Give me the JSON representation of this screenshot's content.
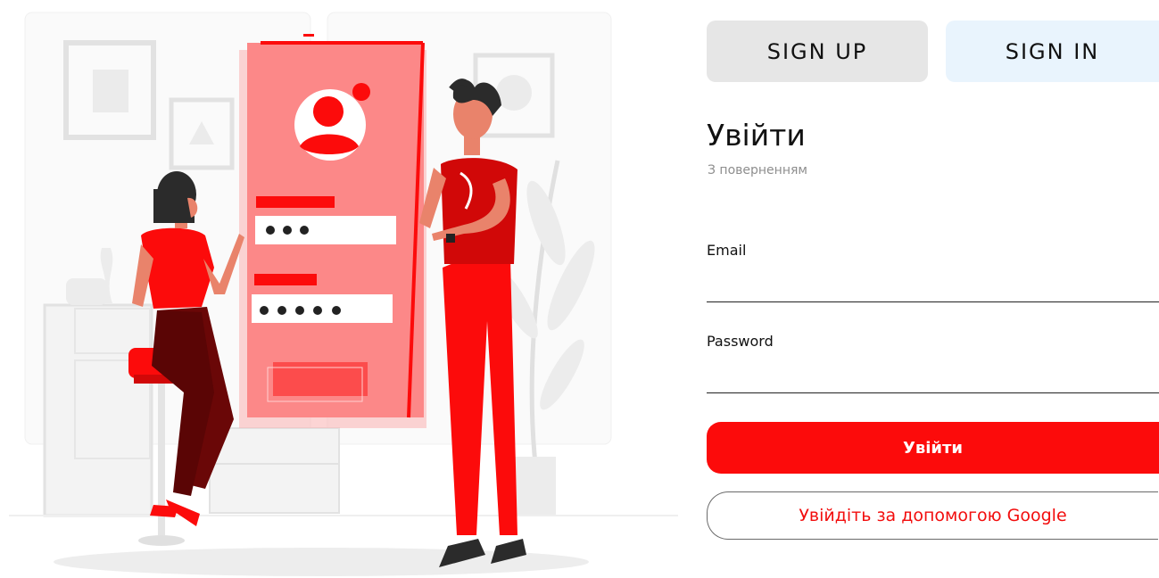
{
  "tabs": {
    "signup": "SIGN UP",
    "signin": "SIGN IN"
  },
  "login": {
    "title": "Увійти",
    "subtitle": "З поверненням",
    "email_label": "Email",
    "email_value": "",
    "password_label": "Password",
    "password_value": "",
    "submit_label": "Увійти",
    "google_label": "Увійдіть за допомогою Google"
  },
  "colors": {
    "accent": "#fc0b0b",
    "signup_tab_bg": "#e6e6e6",
    "signin_tab_bg": "#e9f4fd"
  },
  "illustration": {
    "name": "login-illustration"
  }
}
